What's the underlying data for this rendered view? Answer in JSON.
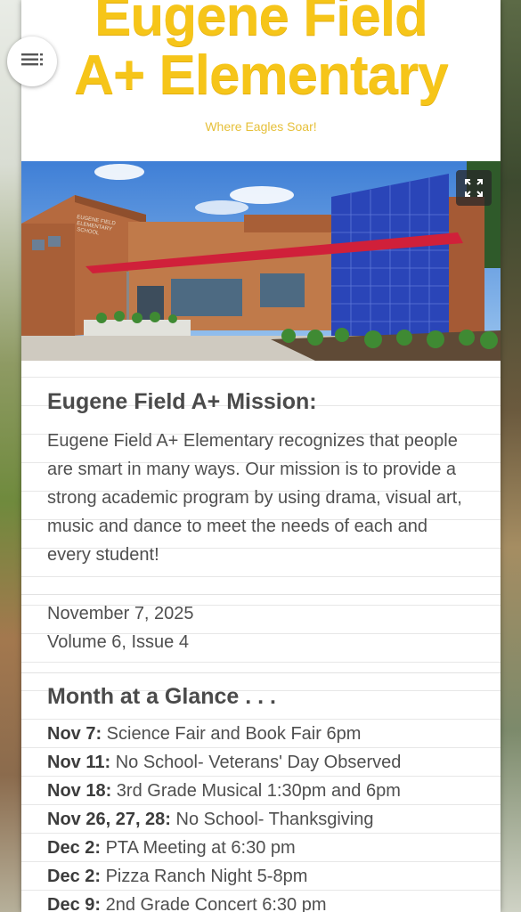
{
  "header": {
    "school_name_line1": "Eugene Field",
    "school_name_line2": "A+ Elementary",
    "tagline": "Where Eagles Soar!"
  },
  "menu": {
    "icon": "menu-list-icon"
  },
  "photo": {
    "sign_text_line1": "EUGENE FIELD",
    "sign_text_line2": "ELEMENTARY",
    "sign_text_line3": "SCHOOL",
    "expand_icon": "fullscreen-icon"
  },
  "mission": {
    "title": "Eugene Field A+ Mission:",
    "text": "Eugene Field A+ Elementary recognizes that people are smart in many ways. Our mission is to provide a strong academic program by using drama, visual art, music and dance to meet the needs of each and every student!"
  },
  "issue": {
    "date": "November 7, 2025",
    "volume": "Volume 6, Issue 4"
  },
  "glance": {
    "title": "Month at a Glance . . .",
    "events": [
      {
        "date": "Nov 7:",
        "desc": " Science Fair and Book Fair 6pm"
      },
      {
        "date": "Nov 11:",
        "desc": " No School- Veterans' Day Observed"
      },
      {
        "date": "Nov 18:",
        "desc": " 3rd Grade Musical 1:30pm and 6pm"
      },
      {
        "date": "Nov 26, 27, 28:",
        "desc": " No School- Thanksgiving"
      },
      {
        "date": "Dec 2:",
        "desc": " PTA Meeting at 6:30 pm"
      },
      {
        "date": "Dec 2:",
        "desc": " Pizza Ranch Night 5-8pm"
      },
      {
        "date": "Dec 9:",
        "desc": " 2nd Grade Concert 6:30 pm"
      }
    ]
  },
  "colors": {
    "brand_yellow": "#f6c519",
    "text_gray": "#4f4f4f"
  }
}
